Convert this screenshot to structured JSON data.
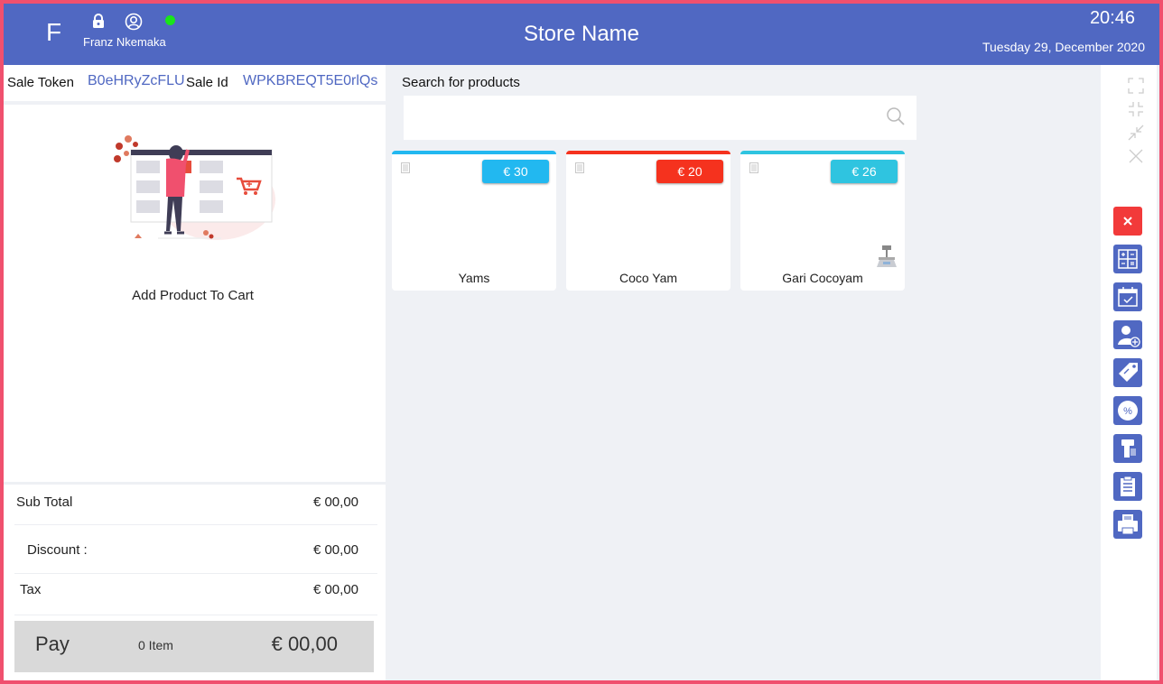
{
  "header": {
    "logo_letter": "F",
    "user_name": "Franz Nkemaka",
    "store_name": "Store Name",
    "time": "20:46",
    "date": "Tuesday 29, December  2020"
  },
  "sale": {
    "token_label": "Sale Token",
    "token_value": "B0eHRyZcFLU",
    "id_label": "Sale  Id",
    "id_value": "WPKBREQT5E0rlQs"
  },
  "cart": {
    "empty_text": "Add Product To Cart"
  },
  "totals": {
    "subtotal_label": "Sub Total",
    "subtotal_value": "€ 00,00",
    "discount_label": "Discount :",
    "discount_value": "€ 00,00",
    "tax_label": "Tax",
    "tax_value": "€ 00,00"
  },
  "pay": {
    "label": "Pay",
    "items": "0 Item",
    "amount": "€ 00,00"
  },
  "search": {
    "label": "Search for products",
    "placeholder": ""
  },
  "products": [
    {
      "name": "Yams",
      "price": "€ 30",
      "color": "#22b8f0"
    },
    {
      "name": "Coco Yam",
      "price": "€ 20",
      "color": "#f5321e"
    },
    {
      "name": "Gari Cocoyam",
      "price": "€ 26",
      "color": "#2fc4e0"
    }
  ],
  "toolbar_icons": [
    "fullscreen-icon",
    "exit-fullscreen-icon",
    "minimize-icon",
    "close-window-icon",
    "cancel-sale-icon",
    "calculator-icon",
    "calendar-icon",
    "add-customer-icon",
    "tag-icon",
    "discount-icon",
    "barcode-scanner-icon",
    "clipboard-icon",
    "printer-icon"
  ],
  "colors": {
    "brand": "#5068c2",
    "border": "#f0506e",
    "online": "#19e619",
    "danger": "#f23a3a"
  }
}
